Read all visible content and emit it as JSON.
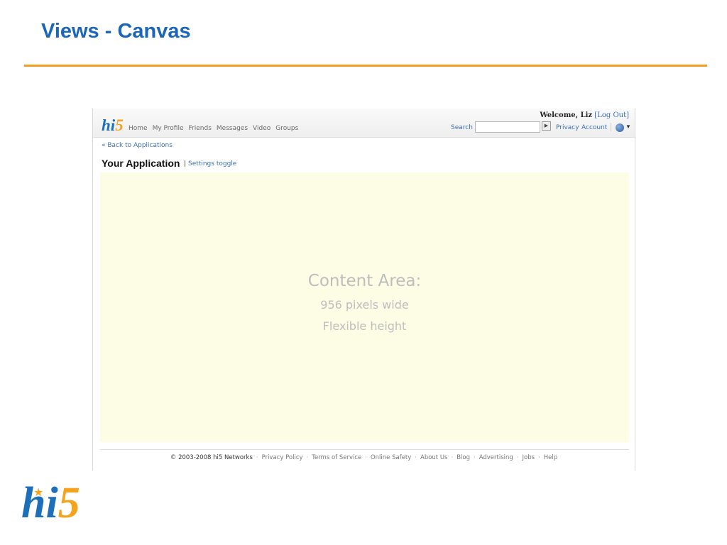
{
  "slide": {
    "title": "Views - Canvas"
  },
  "brand": {
    "hi": "hi",
    "five": "5"
  },
  "header": {
    "nav": [
      "Home",
      "My Profile",
      "Friends",
      "Messages",
      "Video",
      "Groups"
    ],
    "welcome": "Welcome, Liz",
    "logout": "[Log Out]",
    "search_label": "Search",
    "search_value": "",
    "search_go": "▶",
    "privacy": "Privacy",
    "account": "Account"
  },
  "page": {
    "back_link": "« Back to Applications",
    "app_title": "Your Application",
    "settings_sep": "|",
    "settings_link": "Settings toggle"
  },
  "content": {
    "line1": "Content Area:",
    "line2": "956 pixels wide",
    "line3": "Flexible height"
  },
  "footer": {
    "copyright": "© 2003-2008 hi5 Networks",
    "links": [
      "Privacy Policy",
      "Terms of Service",
      "Online Safety",
      "About Us",
      "Blog",
      "Advertising",
      "Jobs",
      "Help"
    ]
  },
  "colors": {
    "title_blue": "#1c66b8",
    "rule_orange": "#f0a020",
    "content_bg": "#fdfde6",
    "link_blue": "#3b6fb6"
  }
}
